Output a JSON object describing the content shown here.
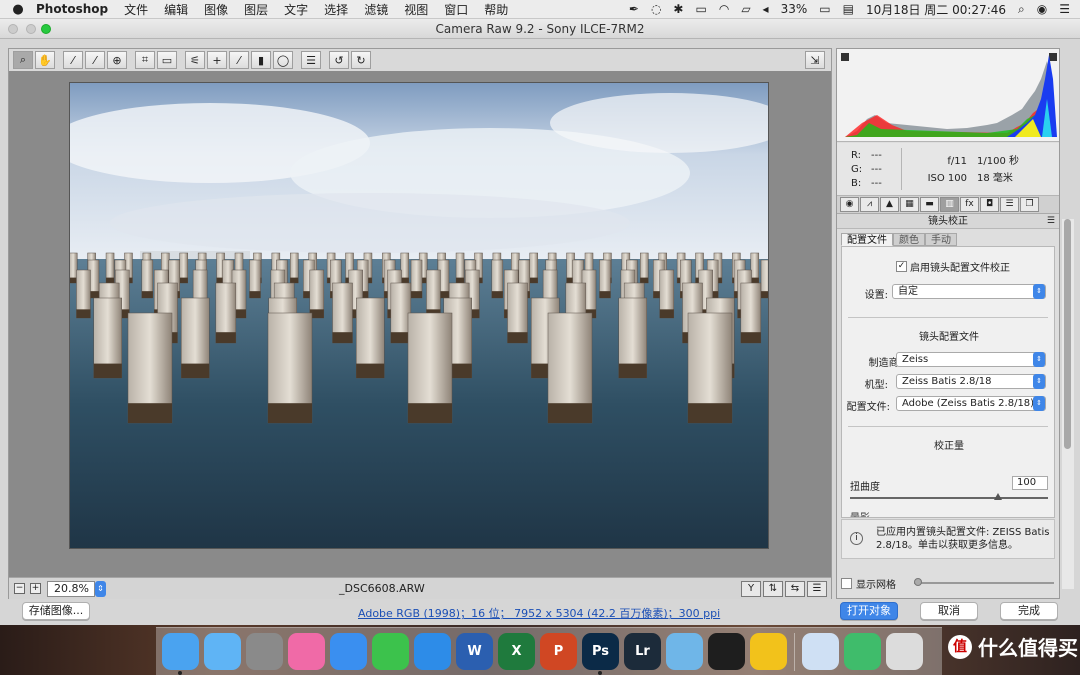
{
  "menubar": {
    "app": "Photoshop",
    "items": [
      "文件",
      "编辑",
      "图像",
      "图层",
      "文字",
      "选择",
      "滤镜",
      "视图",
      "窗口",
      "帮助"
    ],
    "battery": "33%",
    "datetime": "10月18日 周二  00:27:46"
  },
  "window": {
    "title": "Camera Raw 9.2  -  Sony ILCE-7RM2"
  },
  "toolbar": {
    "tools": [
      "zoom-icon",
      "hand-icon",
      "white-balance-icon",
      "color-sampler-icon",
      "target-adjust-icon",
      "crop-icon",
      "straighten-icon",
      "spot-removal-icon",
      "red-eye-icon",
      "adjustment-brush-icon",
      "graduated-filter-icon",
      "radial-filter-icon",
      "preferences-icon",
      "rotate-left-icon",
      "rotate-right-icon"
    ]
  },
  "status": {
    "zoom": "20.8%",
    "filename": "_DSC6608.ARW"
  },
  "info": {
    "r_label": "R:",
    "r_val": "---",
    "g_label": "G:",
    "g_val": "---",
    "b_label": "B:",
    "b_val": "---",
    "aperture": "f/11",
    "shutter": "1/100 秒",
    "iso": "ISO 100",
    "focal": "18 毫米"
  },
  "panel": {
    "title": "镜头校正",
    "subtabs": [
      "配置文件",
      "颜色",
      "手动"
    ],
    "enable_profile": "启用镜头配置文件校正",
    "setup_label": "设置:",
    "setup_value": "自定",
    "profile_section": "镜头配置文件",
    "make_label": "制造商:",
    "make_value": "Zeiss",
    "model_label": "机型:",
    "model_value": "Zeiss Batis 2.8/18",
    "profile_label": "配置文件:",
    "profile_value": "Adobe (Zeiss Batis 2.8/18)",
    "amount_section": "校正量",
    "distortion_label": "扭曲度",
    "distortion_value": "100",
    "distortion_level": 100,
    "vignette_label": "暈影",
    "note": "已应用内置镜头配置文件: ZEISS Batis 2.8/18。单击以获取更多信息。",
    "grid_label": "显示网格"
  },
  "bottom": {
    "save": "存储图像...",
    "workflow": "Adobe RGB (1998)；16 位；  7952 x 5304 (42.2 百万像素)；300 ppi",
    "open": "打开对象",
    "cancel": "取消",
    "done": "完成"
  },
  "dock": [
    {
      "name": "finder-icon",
      "color": "#4aa3f0"
    },
    {
      "name": "messages-icon",
      "color": "#5fb4f5"
    },
    {
      "name": "system-preferences-icon",
      "color": "#8a8a8a"
    },
    {
      "name": "itunes-icon",
      "color": "#f06aa7"
    },
    {
      "name": "app-store-icon",
      "color": "#3a8ff0"
    },
    {
      "name": "facetime-icon",
      "color": "#3cc24c"
    },
    {
      "name": "safari-icon",
      "color": "#2d8ce8"
    },
    {
      "name": "word-icon",
      "color": "#2b5fb0",
      "text": "W"
    },
    {
      "name": "excel-icon",
      "color": "#1f7a3d",
      "text": "X"
    },
    {
      "name": "powerpoint-icon",
      "color": "#d04723",
      "text": "P"
    },
    {
      "name": "photoshop-icon",
      "color": "#0b2a47",
      "text": "Ps"
    },
    {
      "name": "lightroom-icon",
      "color": "#1c2b3a",
      "text": "Lr"
    },
    {
      "name": "airmail-icon",
      "color": "#6fb6e8"
    },
    {
      "name": "qq-icon",
      "color": "#1e1e1e"
    },
    {
      "name": "qq-music-icon",
      "color": "#f2c21b"
    },
    {
      "name": "bt-download-icon",
      "color": "#cfe0f4"
    },
    {
      "name": "weather-icon",
      "color": "#3fbc6b"
    },
    {
      "name": "trash-icon",
      "color": "#dcdcdc"
    }
  ],
  "watermark": {
    "badge": "值",
    "text": "什么值得买"
  }
}
